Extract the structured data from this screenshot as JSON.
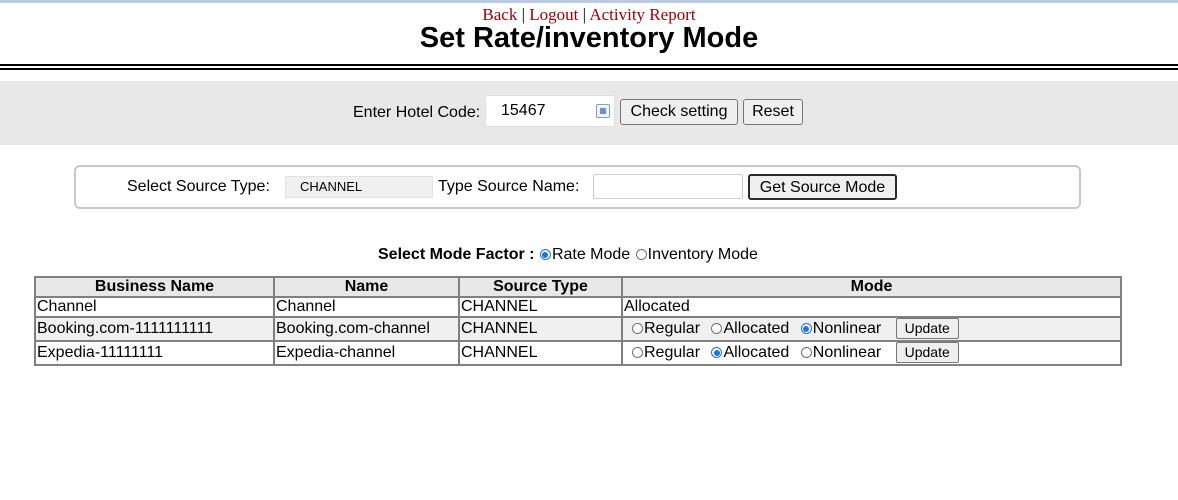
{
  "nav": {
    "back": "Back",
    "logout": "Logout",
    "activity": "Activity Report",
    "sep": "|"
  },
  "page": {
    "title": "Set Rate/inventory Mode"
  },
  "hotel": {
    "label": "Enter Hotel Code:",
    "value": "15467",
    "check_label": "Check setting",
    "reset_label": "Reset"
  },
  "source": {
    "type_label": "Select Source Type:",
    "type_value": "CHANNEL",
    "name_label": "Type Source Name:",
    "name_value": "",
    "get_label": "Get Source Mode"
  },
  "mode_factor": {
    "label": "Select Mode Factor :",
    "options": [
      {
        "label": "Rate Mode",
        "selected": true
      },
      {
        "label": "Inventory Mode",
        "selected": false
      }
    ]
  },
  "table": {
    "headers": [
      "Business Name",
      "Name",
      "Source Type",
      "Mode"
    ],
    "rows": [
      {
        "business": "Channel",
        "name": "Channel",
        "source_type": "CHANNEL",
        "mode_text": "Allocated"
      },
      {
        "business": "Booking.com-1111111111",
        "name": "Booking.com-channel",
        "source_type": "CHANNEL",
        "mode_selected": "Nonlinear"
      },
      {
        "business": "Expedia-11111111",
        "name": "Expedia-channel",
        "source_type": "CHANNEL",
        "mode_selected": "Allocated"
      }
    ],
    "mode_options": [
      "Regular",
      "Allocated",
      "Nonlinear"
    ],
    "update_label": "Update"
  },
  "colors": {
    "link": "#a30000",
    "radio_selected": "#1a73e8",
    "panel_bg": "#e8e8e8"
  },
  "icons": {
    "date_field": "calendar-icon"
  }
}
